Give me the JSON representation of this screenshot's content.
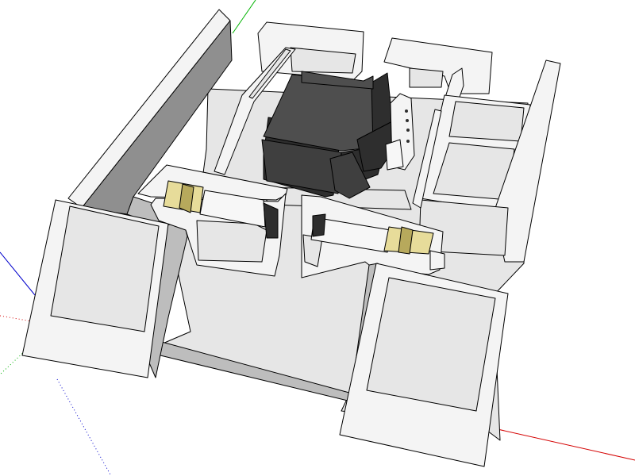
{
  "scene": {
    "background": "#ffffff",
    "colors": {
      "part_white": "#f4f4f4",
      "part_face": "#e6e6e6",
      "part_shadow": "#bdbdbd",
      "part_dark_side": "#8f8f8f",
      "edge": "#000000",
      "servo_body": "#3f3f3f",
      "servo_top": "#4e4e4e",
      "servo_side": "#2e2e2e",
      "gear_brass": "#e7dc9a",
      "gear_brass_dark": "#b7a95c",
      "motor_can": "#f7f7f7",
      "axis_red": "#d40000",
      "axis_green": "#00b300",
      "axis_blue": "#0000cc"
    }
  }
}
